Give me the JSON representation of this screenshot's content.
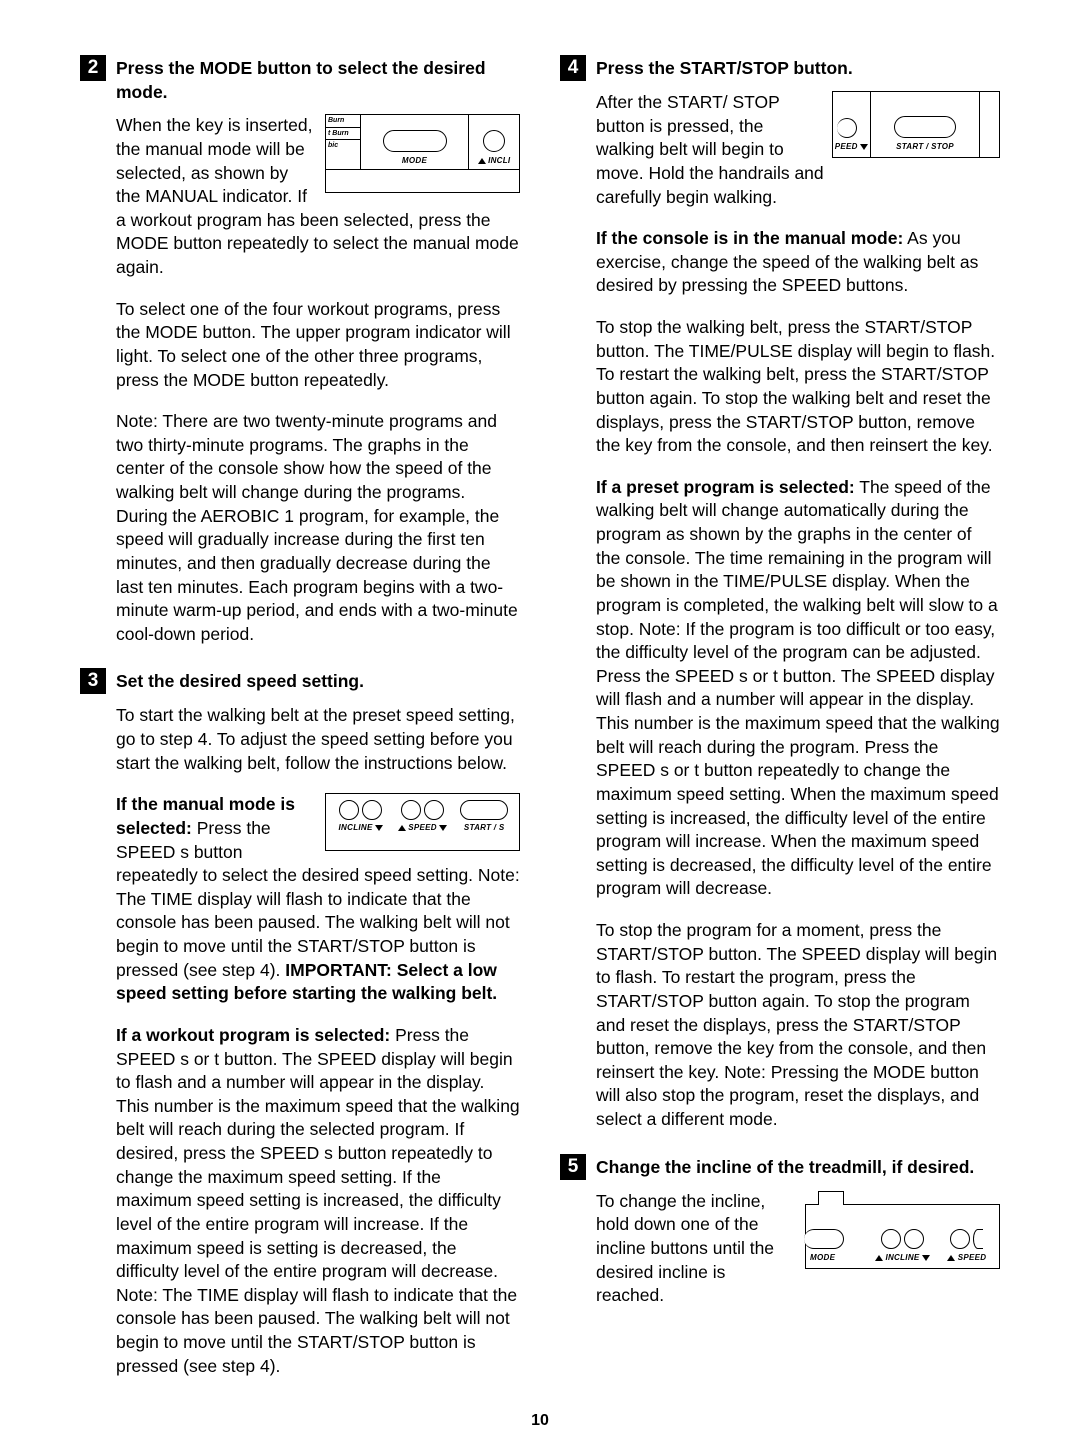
{
  "page_number": "10",
  "steps": {
    "s2": {
      "num": "2",
      "title": "Press the MODE button to select the desired mode.",
      "p1a": "When the key is inserted, the manual mode will be selected, as shown by the MANUAL indicator. If a workout ",
      "p1b": "program has been selected, press the MODE button repeatedly to select the manual mode again.",
      "p2": "To select one of the four workout programs, press the MODE button. The upper program indicator will light. To select one of the other three programs, press the MODE button repeatedly.",
      "p3": "Note: There are two twenty-minute programs and two thirty-minute programs. The graphs in the center of the console show how the speed of the walking belt will change during the programs. During the AEROBIC 1 program, for example, the speed will gradually increase during the first ten minutes, and then gradually decrease during the last ten minutes. Each program begins with a two-minute warm-up period, and ends with a two-minute cool-down period.",
      "fig": {
        "l1": "Burn",
        "l2": "t Burn",
        "l3": "bic",
        "mode": "MODE",
        "incli": "INCLI"
      }
    },
    "s3": {
      "num": "3",
      "title": "Set the desired speed setting.",
      "p1": "To start the walking belt at the preset speed setting, go to step 4. To adjust the speed setting before you start the walking belt, follow the instructions below.",
      "p2a_bold": "If the manual mode is selected:",
      "p2a": " Press the SPEED ",
      "p2a_sym": "s",
      "p2a2": " button repeatedly to select the desired speed setting. Note: The ",
      "p2b": "TIME display will flash to indicate that the console has been paused. The walking belt will not begin to move until the START/STOP button is pressed (see step 4). ",
      "p2c_bold": "IMPORTANT: Select a low speed setting before starting the walking belt.",
      "p3_bold": "If a workout program is selected:",
      "p3a": " Press the SPEED ",
      "p3_sym1": "s",
      "p3b": " or ",
      "p3_sym2": "t",
      "p3c": " button. The SPEED display will begin to flash and a number will appear in the display. This number is the maximum speed that the walking belt will reach during the selected program. If desired, press the SPEED ",
      "p3_sym3": "s",
      "p3d": " button repeatedly to change the maximum speed setting. If the maximum speed setting is increased, the difficulty level of the entire program will increase. If the maximum speed is setting is decreased, the difficulty level of the entire program will decrease. Note: The TIME display will flash to indicate that the console has been paused. The walking belt will not begin to move until the START/STOP button is pressed (see step 4).",
      "fig": {
        "incline": "INCLINE",
        "speed": "SPEED",
        "start": "START / S"
      }
    },
    "s4": {
      "num": "4",
      "title": "Press the START/STOP button.",
      "p1": "After the START/ STOP button is pressed, the walking belt will begin to move. Hold the handrails and carefully begin walking.",
      "p2_bold": "If the console is in the manual mode:",
      "p2": " As you exercise, change the speed of the walking belt as desired by pressing the SPEED buttons.",
      "p3": "To stop the walking belt, press the START/STOP button. The TIME/PULSE display will begin to flash. To restart the walking belt, press the START/STOP button again. To stop the walking belt and reset the displays, press the START/STOP button, remove the key from the console, and then reinsert the key.",
      "p4_bold": "If a preset program is selected:",
      "p4a": " The speed of the walking belt will change automatically during the program as shown by the graphs in the center of the console. The time remaining in the program will be shown in the TIME/PULSE display. When the program is completed, the walking belt will slow to a stop. Note: If the program is too difficult or too easy, the difficulty level of the program can be adjusted. Press the SPEED ",
      "p4_sym1": "s",
      "p4b": " or ",
      "p4_sym2": "t",
      "p4c": " button. The SPEED display will flash and a number will appear in the display. This number is the maximum speed that the walking belt will reach during the program. Press the SPEED ",
      "p4_sym3": "s",
      "p4d": " or ",
      "p4_sym4": "t",
      "p4e": " button repeatedly to change the maximum speed setting. When the maximum speed setting is increased, the difficulty level of the entire program will increase. When the maximum speed setting is decreased, the difficulty level of the entire program will decrease.",
      "p5": "To stop the program for a moment, press the START/STOP button. The SPEED display will begin to flash. To restart the program, press the START/STOP button again. To stop the program and reset the displays, press the START/STOP button, remove the key from the console, and then reinsert the key. Note: Pressing the MODE button will also stop the program, reset the displays, and select a different mode.",
      "fig": {
        "peed": "PEED",
        "startstop": "START / STOP"
      }
    },
    "s5": {
      "num": "5",
      "title": "Change the incline of the treadmill, if desired.",
      "p1": "To change the incline, hold down one of the incline buttons until the desired incline is reached.",
      "fig": {
        "mode": "MODE",
        "incline": "INCLINE",
        "speed": "SPEED"
      }
    }
  }
}
